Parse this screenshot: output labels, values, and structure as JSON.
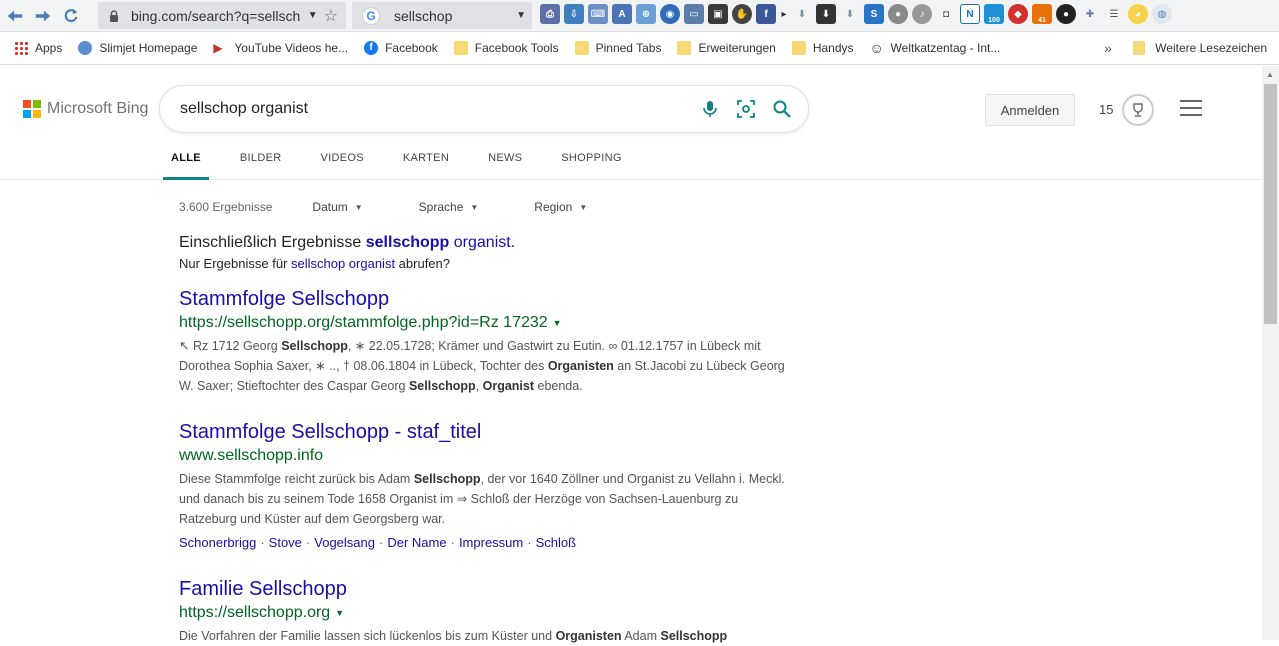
{
  "browser": {
    "url": "bing.com/search?q=sellsch",
    "search_ext_query": "sellschop",
    "bookmarks": [
      {
        "label": "Apps",
        "icon": "apps-grid-icon"
      },
      {
        "label": "Slimjet Homepage",
        "icon": "globe-icon"
      },
      {
        "label": "YouTube Videos he...",
        "icon": "youtube-icon"
      },
      {
        "label": "Facebook",
        "icon": "facebook-icon"
      },
      {
        "label": "Facebook Tools",
        "icon": "folder-icon"
      },
      {
        "label": "Pinned Tabs",
        "icon": "folder-icon"
      },
      {
        "label": "Erweiterungen",
        "icon": "folder-icon"
      },
      {
        "label": "Handys",
        "icon": "folder-icon"
      },
      {
        "label": "Weltkatzentag - Int...",
        "icon": "smiley-icon"
      }
    ],
    "more_bookmarks": "»",
    "other_bookmarks": "Weitere Lesezeichen",
    "ext_badges": {
      "badge1": "100",
      "badge2": "41"
    }
  },
  "bing": {
    "logo_text": "Microsoft Bing",
    "query": "sellschop organist",
    "signin": "Anmelden",
    "rewards": "15",
    "tabs": [
      "ALLE",
      "BILDER",
      "VIDEOS",
      "KARTEN",
      "NEWS",
      "SHOPPING"
    ],
    "result_count": "3.600 Ergebnisse",
    "filters": [
      "Datum",
      "Sprache",
      "Region"
    ],
    "including_prefix": "Einschließlich Ergebnisse ",
    "including_bold": "sellschopp",
    "including_link": " organist",
    "including_suffix": ".",
    "only_prefix": "Nur Ergebnisse für ",
    "only_link": "sellschop organist",
    "only_suffix": " abrufen?"
  },
  "results": [
    {
      "title": "Stammfolge Sellschopp",
      "url": "https://sellschopp.org/stammfolge.php?id=Rz 17232",
      "has_caret": true,
      "snippet_html": "↖ Rz 1712 Georg <b>Sellschopp</b>, ∗ 22.05.1728; Krämer und Gastwirt zu Eutin. ∞ 01.12.1757 in Lübeck mit Dorothea Sophia Saxer, ∗ .., † 08.06.1804 in Lübeck, Tochter des <b>Organisten</b> an St.Jacobi zu Lübeck Georg W. Saxer; Stieftochter des Caspar Georg <b>Sellschopp</b>, <b>Organist</b> ebenda."
    },
    {
      "title": "Stammfolge Sellschopp - staf_titel",
      "url": "www.sellschopp.info",
      "has_caret": false,
      "snippet_html": "Diese Stammfolge reicht zurück bis Adam <b>Sellschopp</b>, der vor 1640 Zöllner und Organist zu Vellahn i. Meckl. und danach bis zu seinem Tode 1658 Organist im ⇒ Schloß der Herzöge von Sachsen-Lauenburg zu Ratzeburg und Küster auf dem Georgsberg war.",
      "deeplinks": [
        "Schonerbrigg",
        "Stove",
        "Vogelsang",
        "Der Name",
        "Impressum",
        "Schloß"
      ]
    },
    {
      "title": "Familie Sellschopp",
      "url": "https://sellschopp.org",
      "has_caret": true,
      "snippet_html": "Die Vorfahren der Familie lassen sich lückenlos bis zum Küster und <b>Organisten</b> Adam <b>Sellschopp</b>"
    }
  ],
  "colors": {
    "link": "#1a0dab",
    "url_green": "#006621",
    "tab_underline": "#0c8484",
    "ms_red": "#f25022",
    "ms_green": "#7fba00",
    "ms_blue": "#00a4ef",
    "ms_yellow": "#ffb900"
  }
}
